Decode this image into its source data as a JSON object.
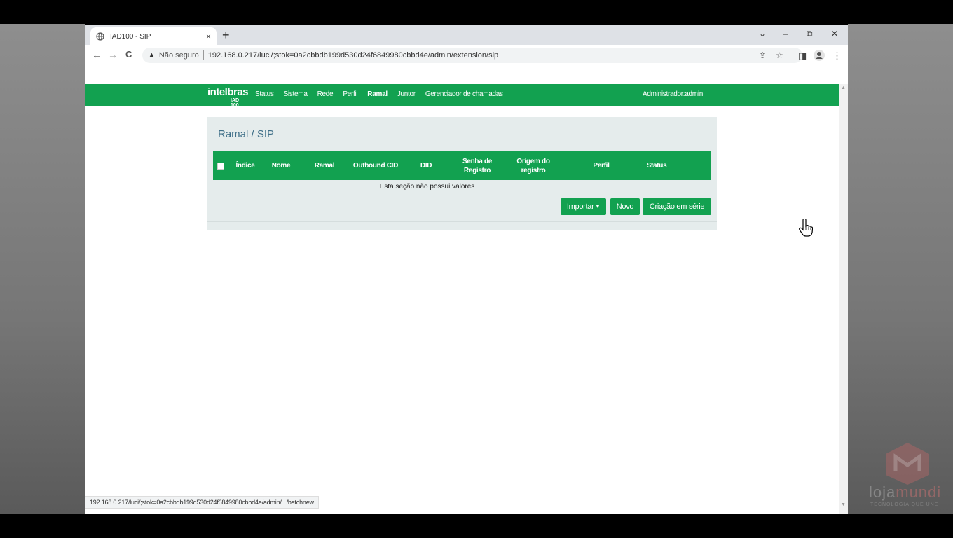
{
  "tab": {
    "title": "IAD100 - SIP",
    "close": "×",
    "new": "+"
  },
  "window": {
    "dropdown": "⌄",
    "minimize": "–",
    "restore": "⧉",
    "close": "✕"
  },
  "toolbar": {
    "back": "←",
    "forward": "→",
    "reload": "C",
    "security_icon": "warning-icon",
    "security_text": "Não seguro",
    "url": "192.168.0.217/luci/;stok=0a2cbbdb199d530d24f6849980cbbd4e/admin/extension/sip"
  },
  "app": {
    "brand": "intelbras",
    "model": "IAD 100",
    "nav": [
      "Status",
      "Sistema",
      "Rede",
      "Perfil",
      "Ramal",
      "Juntor",
      "Gerenciador de chamadas"
    ],
    "active_nav": "Ramal",
    "user": "Administrador:admin"
  },
  "panel": {
    "title": "Ramal / SIP",
    "columns": [
      "Índice",
      "Nome",
      "Ramal",
      "Outbound CID",
      "DID",
      "Senha de Registro",
      "Origem do registro",
      "Perfil",
      "Status"
    ],
    "empty_message": "Esta seção não possui valores",
    "buttons": {
      "import": "Importar",
      "new": "Novo",
      "batch": "Criação em série"
    }
  },
  "status_url": "192.168.0.217/luci/;stok=0a2cbbdb199d530d24f6849980cbbd4e/admin/.../batchnew",
  "watermark": {
    "text_a": "loja",
    "text_b": "mundi",
    "sub": "TECNOLOGIA QUE UNE"
  },
  "colors": {
    "green": "#12a150",
    "panel_bg": "#e5ecec",
    "title": "#3f6f88"
  }
}
